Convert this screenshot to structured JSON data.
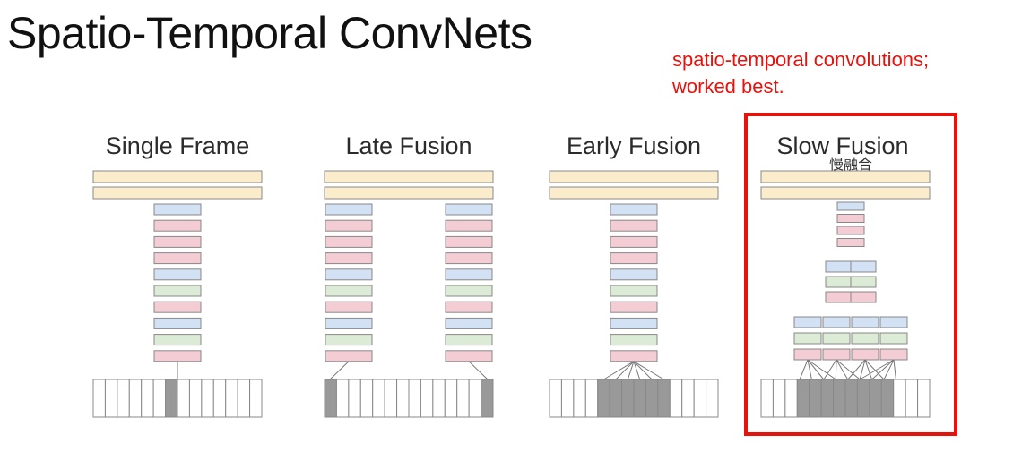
{
  "slide_title": "Spatio-Temporal ConvNets",
  "annotation": {
    "line1": "spatio-temporal convolutions;",
    "line2": "worked best."
  },
  "highlight_color": "#e8120c",
  "colors": {
    "fc_layer": "#fbeccb",
    "conv_blue": "#d3e1f4",
    "conv_pink": "#f4ccd3",
    "conv_green": "#dcebd5",
    "frame_active": "#999999",
    "stroke": "#888888"
  },
  "panels": [
    {
      "title": "Single Frame",
      "active_frames": [
        6
      ]
    },
    {
      "title": "Late Fusion",
      "active_frames": [
        0,
        13
      ]
    },
    {
      "title": "Early Fusion",
      "active_frames": [
        4,
        5,
        6,
        7,
        8,
        9
      ]
    },
    {
      "title": "Slow Fusion",
      "active_frames": [
        3,
        4,
        5,
        6,
        7,
        8,
        9,
        10
      ]
    }
  ],
  "layer_stack": [
    "blue",
    "pink",
    "pink",
    "pink",
    "blue",
    "green",
    "pink",
    "blue",
    "green",
    "pink"
  ],
  "slow_fusion": {
    "note": "慢融合",
    "top_stack": [
      "blue",
      "pink",
      "pink",
      "pink"
    ],
    "mid_stack": [
      "blue",
      "green",
      "pink"
    ],
    "bottom_stack": [
      "blue",
      "green",
      "pink"
    ]
  }
}
